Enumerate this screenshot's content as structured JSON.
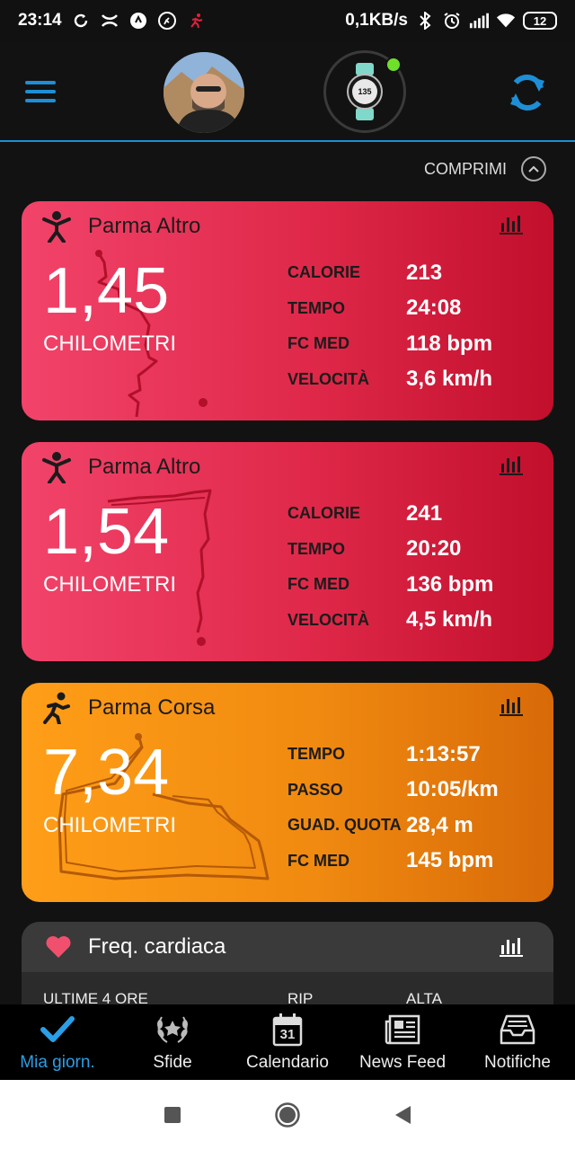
{
  "status_bar": {
    "time": "23:14",
    "network_speed": "0,1KB/s",
    "battery": "12",
    "left_icons": [
      "sync-icon",
      "under-armour-icon",
      "strava-icon",
      "running-app-icon",
      "runner-red-icon"
    ],
    "right_icons": [
      "bluetooth-icon",
      "alarm-icon",
      "signal-icon",
      "wifi-icon"
    ]
  },
  "header": {
    "menu_icon": "hamburger-icon",
    "watch_screen_value": "135",
    "sync_icon": "sync-icon",
    "accent": "#1e8fd6",
    "connected_color": "#6ee02a"
  },
  "collapse": {
    "label": "COMPRIMI",
    "icon": "chevron-up-icon"
  },
  "activities": [
    {
      "title": "Parma Altro",
      "icon": "stick-figure-icon",
      "distance": "1,45",
      "unit": "CHILOMETRI",
      "color": "red",
      "stats": [
        {
          "label": "CALORIE",
          "value": "213"
        },
        {
          "label": "TEMPO",
          "value": "24:08"
        },
        {
          "label": "FC MED",
          "value": "118 bpm"
        },
        {
          "label": "VELOCITÀ",
          "value": "3,6 km/h"
        }
      ]
    },
    {
      "title": "Parma Altro",
      "icon": "stick-figure-icon",
      "distance": "1,54",
      "unit": "CHILOMETRI",
      "color": "red",
      "stats": [
        {
          "label": "CALORIE",
          "value": "241"
        },
        {
          "label": "TEMPO",
          "value": "20:20"
        },
        {
          "label": "FC MED",
          "value": "136 bpm"
        },
        {
          "label": "VELOCITÀ",
          "value": "4,5 km/h"
        }
      ]
    },
    {
      "title": "Parma Corsa",
      "icon": "running-icon",
      "distance": "7,34",
      "unit": "CHILOMETRI",
      "color": "orange",
      "stats": [
        {
          "label": "TEMPO",
          "value": "1:13:57"
        },
        {
          "label": "PASSO",
          "value": "10:05/km"
        },
        {
          "label": "GUAD. QUOTA",
          "value": "28,4 m"
        },
        {
          "label": "FC MED",
          "value": "145 bpm"
        }
      ]
    }
  ],
  "heart_rate": {
    "title": "Freq. cardiaca",
    "icon": "heart-icon",
    "columns": [
      "ULTIME 4 ORE",
      "RIP",
      "ALTA"
    ]
  },
  "bottom_nav": [
    {
      "label": "Mia giorn.",
      "icon": "checkmark-icon",
      "active": true
    },
    {
      "label": "Sfide",
      "icon": "laurel-icon",
      "active": false
    },
    {
      "label": "Calendario",
      "icon": "calendar-icon",
      "active": false,
      "calendar_day": "31"
    },
    {
      "label": "News Feed",
      "icon": "newspaper-icon",
      "active": false
    },
    {
      "label": "Notifiche",
      "icon": "inbox-icon",
      "active": false
    }
  ]
}
